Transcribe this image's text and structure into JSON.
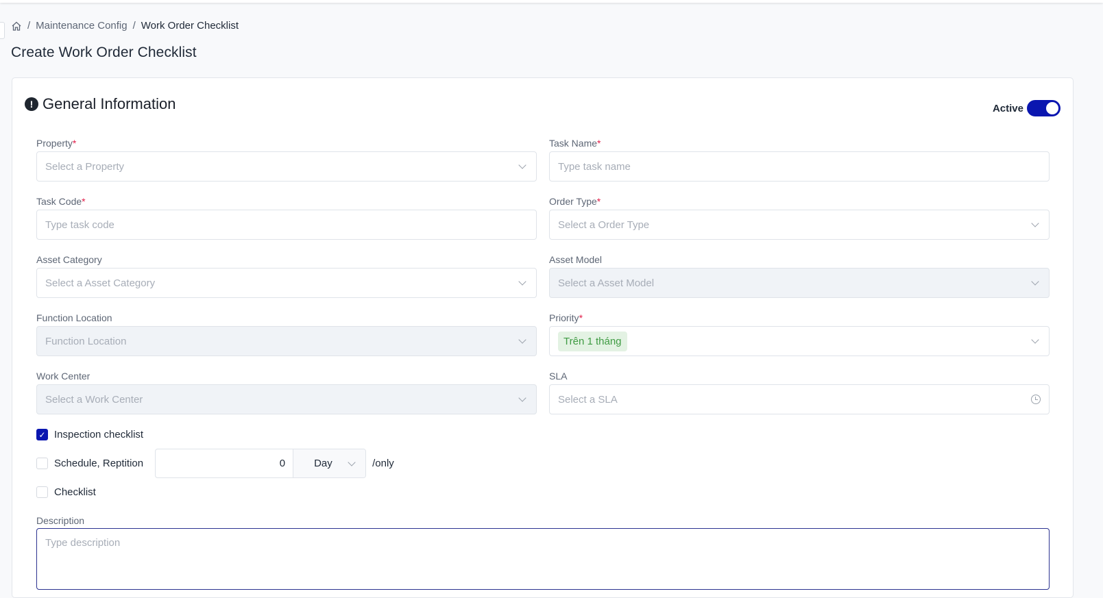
{
  "breadcrumb": {
    "items": [
      "Maintenance Config",
      "Work Order Checklist"
    ],
    "sep": "/"
  },
  "page_title": "Create Work Order Checklist",
  "section": {
    "title": "General Information",
    "active_label": "Active",
    "active": true
  },
  "fields": {
    "property": {
      "label": "Property",
      "placeholder": "Select a Property",
      "req": "*"
    },
    "task_name": {
      "label": "Task Name",
      "placeholder": "Type task name",
      "req": "*"
    },
    "task_code": {
      "label": "Task Code",
      "placeholder": "Type task code",
      "req": "*"
    },
    "order_type": {
      "label": "Order Type",
      "placeholder": "Select a Order Type",
      "req": "*"
    },
    "asset_category": {
      "label": "Asset Category",
      "placeholder": "Select a Asset Category"
    },
    "asset_model": {
      "label": "Asset Model",
      "placeholder": "Select a Asset Model"
    },
    "function_location": {
      "label": "Function Location",
      "placeholder": "Function Location"
    },
    "priority": {
      "label": "Priority",
      "value": "Trên 1 tháng",
      "req": "*"
    },
    "work_center": {
      "label": "Work Center",
      "placeholder": "Select a Work Center"
    },
    "sla": {
      "label": "SLA",
      "placeholder": "Select a SLA"
    }
  },
  "checks": {
    "inspection": "Inspection checklist",
    "schedule": "Schedule, Reptition",
    "checklist": "Checklist",
    "check_mark": "✓"
  },
  "repetition": {
    "value": "0",
    "unit": "Day",
    "suffix": "/only"
  },
  "description": {
    "label": "Description",
    "placeholder": "Type description"
  }
}
